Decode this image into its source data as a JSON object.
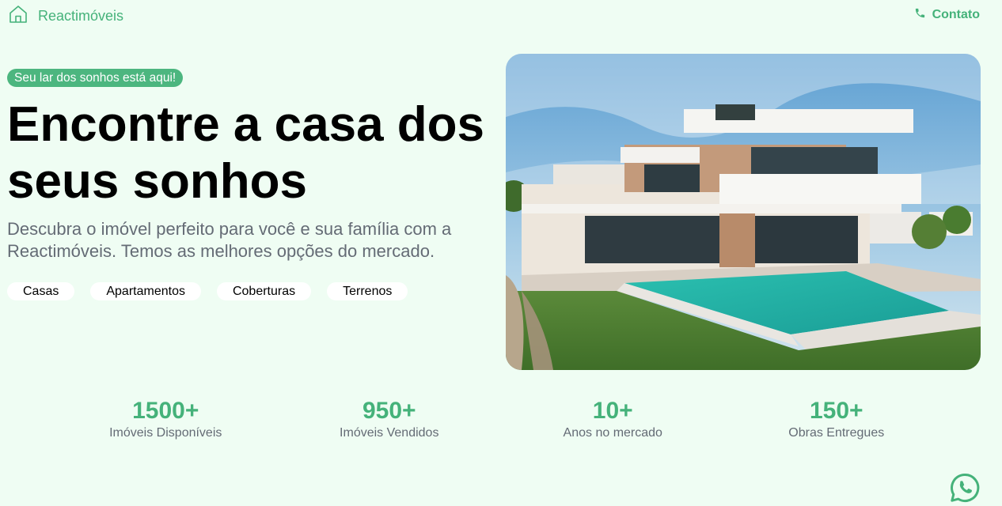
{
  "header": {
    "brand_name": "Reactimóveis",
    "brand_icon": "house-icon",
    "contact_label": "Contato",
    "contact_icon": "phone-icon"
  },
  "hero": {
    "badge": "Seu lar dos sonhos está aqui!",
    "title": "Encontre a casa dos seus sonhos",
    "subtitle": "Descubra o imóvel perfeito para você e sua família com a Reactimóveis. Temos as melhores opções do mercado.",
    "categories": [
      "Casas",
      "Apartamentos",
      "Coberturas",
      "Terrenos"
    ],
    "image": "modern-house-with-pool-photo"
  },
  "stats": [
    {
      "value": "1500+",
      "label": "Imóveis Disponíveis"
    },
    {
      "value": "950+",
      "label": "Imóveis Vendidos"
    },
    {
      "value": "10+",
      "label": "Anos no mercado"
    },
    {
      "value": "150+",
      "label": "Obras Entregues"
    }
  ],
  "floating": {
    "whatsapp_icon": "whatsapp-icon"
  },
  "colors": {
    "background": "#effdf3",
    "accent": "#45b27a",
    "badge": "#4cb67f",
    "muted_text": "#646b75"
  }
}
